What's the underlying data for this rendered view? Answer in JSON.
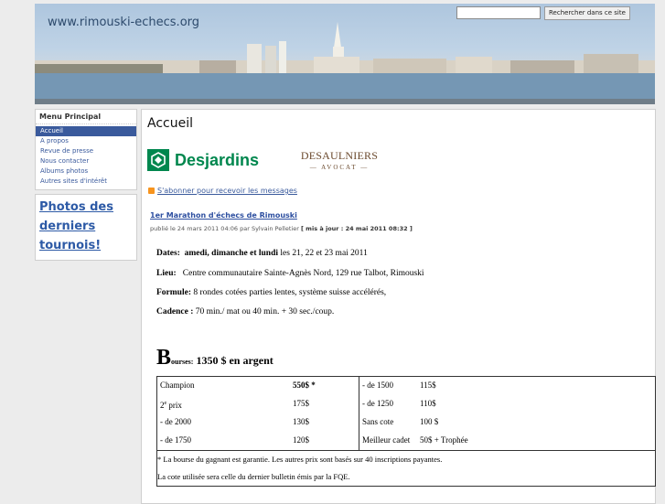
{
  "site": {
    "title": "www.rimouski-echecs.org"
  },
  "search": {
    "placeholder": "",
    "button_label": "Rechercher dans ce site"
  },
  "sidebar": {
    "menu_title": "Menu Principal",
    "items": [
      {
        "label": "Accueil"
      },
      {
        "label": "A propos"
      },
      {
        "label": "Revue de presse"
      },
      {
        "label": "Nous contacter"
      },
      {
        "label": "Albums photos"
      },
      {
        "label": "Autres sites d'intérêt"
      }
    ],
    "photos_link": [
      "Photos des",
      "derniers",
      "tournois!"
    ]
  },
  "main": {
    "page_title": "Accueil",
    "sponsor1": "Desjardins",
    "sponsor2_line1": "DESAULNIERS",
    "sponsor2_line2": "AVOCAT",
    "rss_label": "S'abonner pour recevoir les messages",
    "post_title": "1er Marathon d'échecs de Rimouski",
    "post_meta": "publié le 24 mars 2011 04:06 par Sylvain Pelletier",
    "post_updated": "[ mis à jour : 24 mai 2011 08:32 ]",
    "dates_label": "Dates:",
    "dates_bold": "amedi, dimanche et lundi",
    "dates_rest": " les 21, 22 et 23 mai 2011",
    "lieu_label": "Lieu:",
    "lieu_value": "Centre communautaire Sainte-Agnès Nord, 129 rue Talbot, Rimouski",
    "formule_label": "Formule:",
    "formule_value": " 8 rondes cotées parties lentes, système suisse accélérés,",
    "cadence_label": "Cadence :",
    "cadence_value": " 70 min./ mat ou 40 min. + 30 sec./coup.",
    "bourses_big": "B",
    "bourses_small": "ourses:",
    "bourses_rest": " 1350 $ en argent",
    "prizes_left": [
      {
        "label": "Champion",
        "value": "550$  *",
        "bold": true
      },
      {
        "label": "2e prix",
        "value": "175$",
        "bold": false
      },
      {
        "label": "- de 2000",
        "value": "130$",
        "bold": false
      },
      {
        "label": "- de 1750",
        "value": "120$",
        "bold": false
      }
    ],
    "prizes_right": [
      {
        "label": "- de 1500",
        "value": "115$"
      },
      {
        "label": "- de 1250",
        "value": "110$"
      },
      {
        "label": "Sans cote",
        "value": "100 $"
      },
      {
        "label": "Meilleur cadet",
        "value": "50$ + Trophée"
      }
    ],
    "note1": "* La bourse du gagnant est garantie.  Les autres prix sont basés sur 40 inscriptions payantes.",
    "note2": "La cote utilisée sera celle du dernier bulletin émis par la FQE."
  }
}
